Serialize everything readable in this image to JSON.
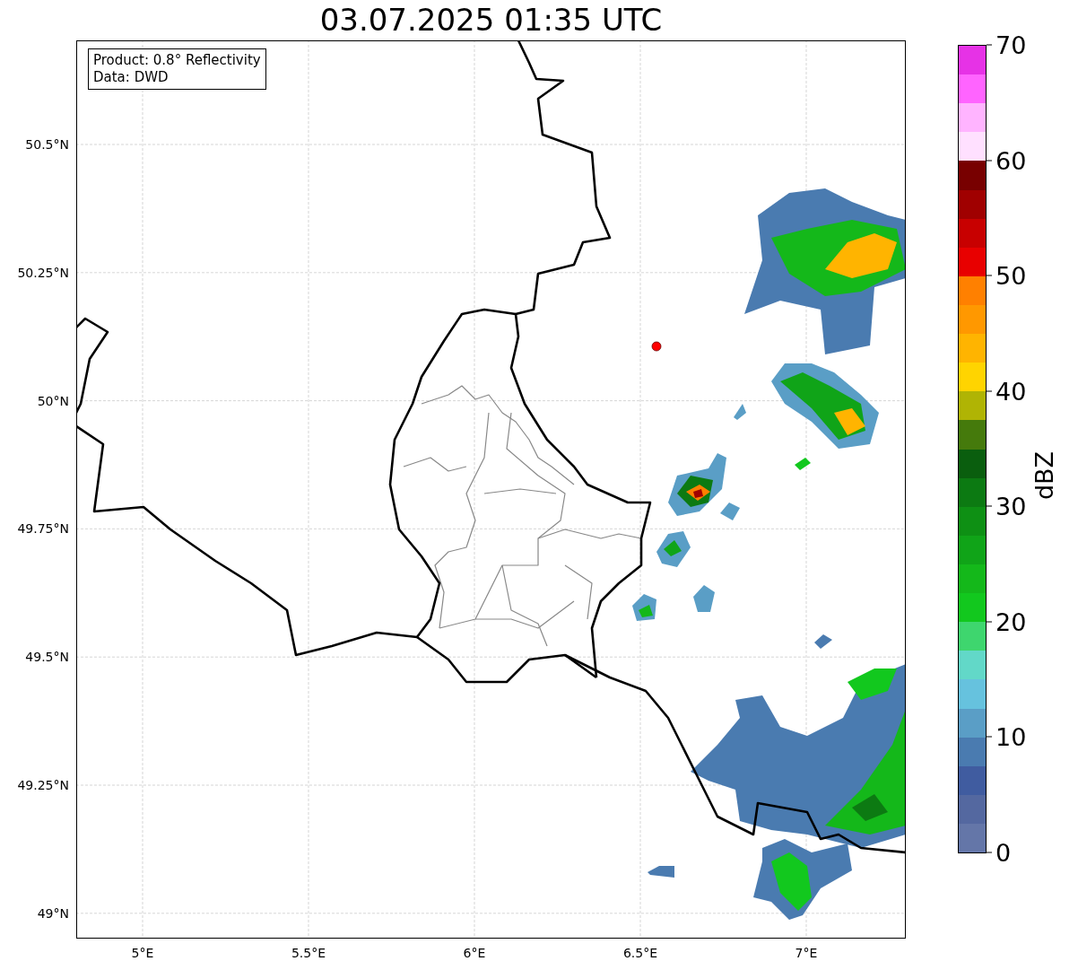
{
  "title": "03.07.2025 01:35 UTC",
  "map": {
    "info_lines": [
      "Product: 0.8° Reflectivity",
      "Data: DWD"
    ],
    "lat_ticks": [
      "50.5°N",
      "50.25°N",
      "50°N",
      "49.75°N",
      "49.5°N",
      "49.25°N",
      "49°N"
    ],
    "lon_ticks": [
      "5°E",
      "5.5°E",
      "6°E",
      "6.5°E",
      "7°E"
    ]
  },
  "colorbar": {
    "label": "dBZ",
    "ticks": [
      "70",
      "60",
      "50",
      "40",
      "30",
      "20",
      "10",
      "0"
    ],
    "bands": [
      {
        "color": "#e632e6"
      },
      {
        "color": "#ff64ff"
      },
      {
        "color": "#ffb4ff"
      },
      {
        "color": "#ffe0ff"
      },
      {
        "color": "#780000"
      },
      {
        "color": "#a00000"
      },
      {
        "color": "#c80000"
      },
      {
        "color": "#e80000"
      },
      {
        "color": "#ff8000"
      },
      {
        "color": "#ff9800"
      },
      {
        "color": "#ffb400"
      },
      {
        "color": "#ffd400"
      },
      {
        "color": "#b0b404"
      },
      {
        "color": "#457a0c"
      },
      {
        "color": "#0a5e0e"
      },
      {
        "color": "#0c7a12"
      },
      {
        "color": "#0e9014"
      },
      {
        "color": "#10a418"
      },
      {
        "color": "#14b81a"
      },
      {
        "color": "#12c81e"
      },
      {
        "color": "#3ed66e"
      },
      {
        "color": "#62d8c8"
      },
      {
        "color": "#66c2de"
      },
      {
        "color": "#5a9ec6"
      },
      {
        "color": "#4a7bb0"
      },
      {
        "color": "#405ca0"
      },
      {
        "color": "#5468a0"
      },
      {
        "color": "#6476a8"
      }
    ]
  }
}
